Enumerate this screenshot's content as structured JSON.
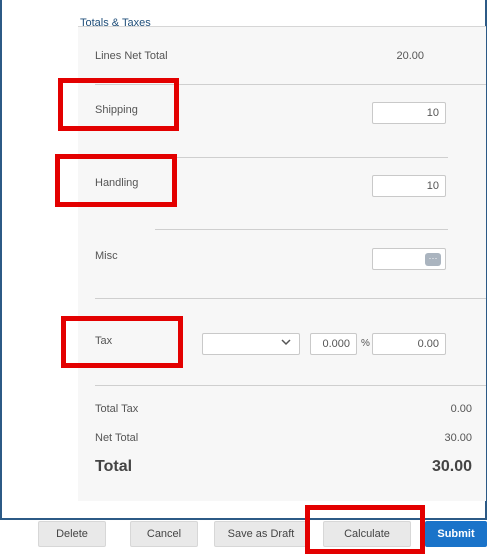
{
  "section": {
    "title": "Totals & Taxes"
  },
  "lines_net_total": {
    "label": "Lines Net Total",
    "value": "20.00"
  },
  "shipping": {
    "label": "Shipping",
    "value": "10"
  },
  "handling": {
    "label": "Handling",
    "value": "10"
  },
  "misc": {
    "label": "Misc",
    "value": "",
    "button_glyph": "···"
  },
  "tax": {
    "label": "Tax",
    "type_value": "",
    "rate": "0.000",
    "percent_sign": "%",
    "amount": "0.00"
  },
  "total_tax": {
    "label": "Total Tax",
    "value": "0.00"
  },
  "net_total": {
    "label": "Net Total",
    "value": "30.00"
  },
  "total": {
    "label": "Total",
    "value": "30.00"
  },
  "footer": {
    "delete": "Delete",
    "cancel": "Cancel",
    "save_as_draft": "Save as Draft",
    "calculate": "Calculate",
    "submit": "Submit"
  },
  "colors": {
    "highlight": "#e30000",
    "primary": "#1a73c9",
    "title": "#1f4e79"
  }
}
